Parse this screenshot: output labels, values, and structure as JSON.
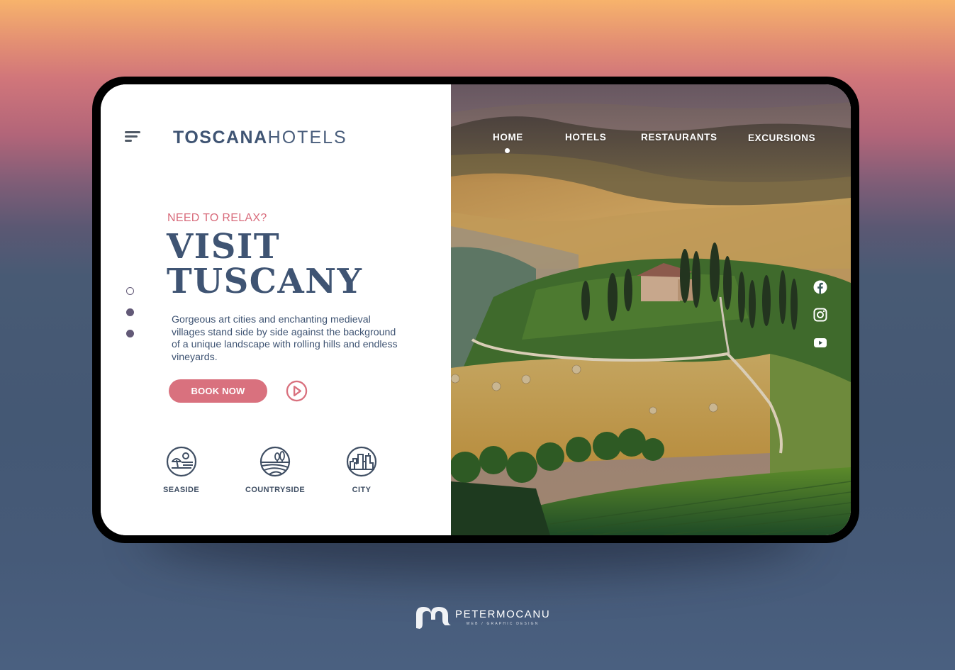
{
  "brand": {
    "name_bold": "TOSCANA",
    "name_light": "HOTELS"
  },
  "nav": {
    "items": [
      {
        "label": "HOME",
        "active": true
      },
      {
        "label": "HOTELS",
        "active": false
      },
      {
        "label": "RESTAURANTS",
        "active": false
      },
      {
        "label": "EXCURSIONS",
        "active": false
      }
    ]
  },
  "hero": {
    "eyebrow": "NEED TO RELAX?",
    "title_line1": "VISIT",
    "title_line2": "TUSCANY",
    "description": "Gorgeous art cities and enchanting medieval villages stand side by side against the background of a unique landscape with rolling hills and endless vineyards.",
    "cta_label": "BOOK NOW",
    "play_icon": "play-circle-icon"
  },
  "slider": {
    "count": 3,
    "active_index": 0
  },
  "categories": [
    {
      "label": "SEASIDE",
      "icon": "seaside-icon"
    },
    {
      "label": "COUNTRYSIDE",
      "icon": "countryside-icon"
    },
    {
      "label": "CITY",
      "icon": "city-icon"
    }
  ],
  "social": [
    {
      "name": "facebook",
      "icon": "facebook-icon"
    },
    {
      "name": "instagram",
      "icon": "instagram-icon"
    },
    {
      "name": "youtube",
      "icon": "youtube-icon"
    }
  ],
  "footer": {
    "designer_name": "PETERMOCANU",
    "designer_tagline": "WEB / GRAPHIC DESIGN"
  },
  "colors": {
    "primary": "#3f5473",
    "accent": "#d9717e",
    "dot": "#625977"
  }
}
